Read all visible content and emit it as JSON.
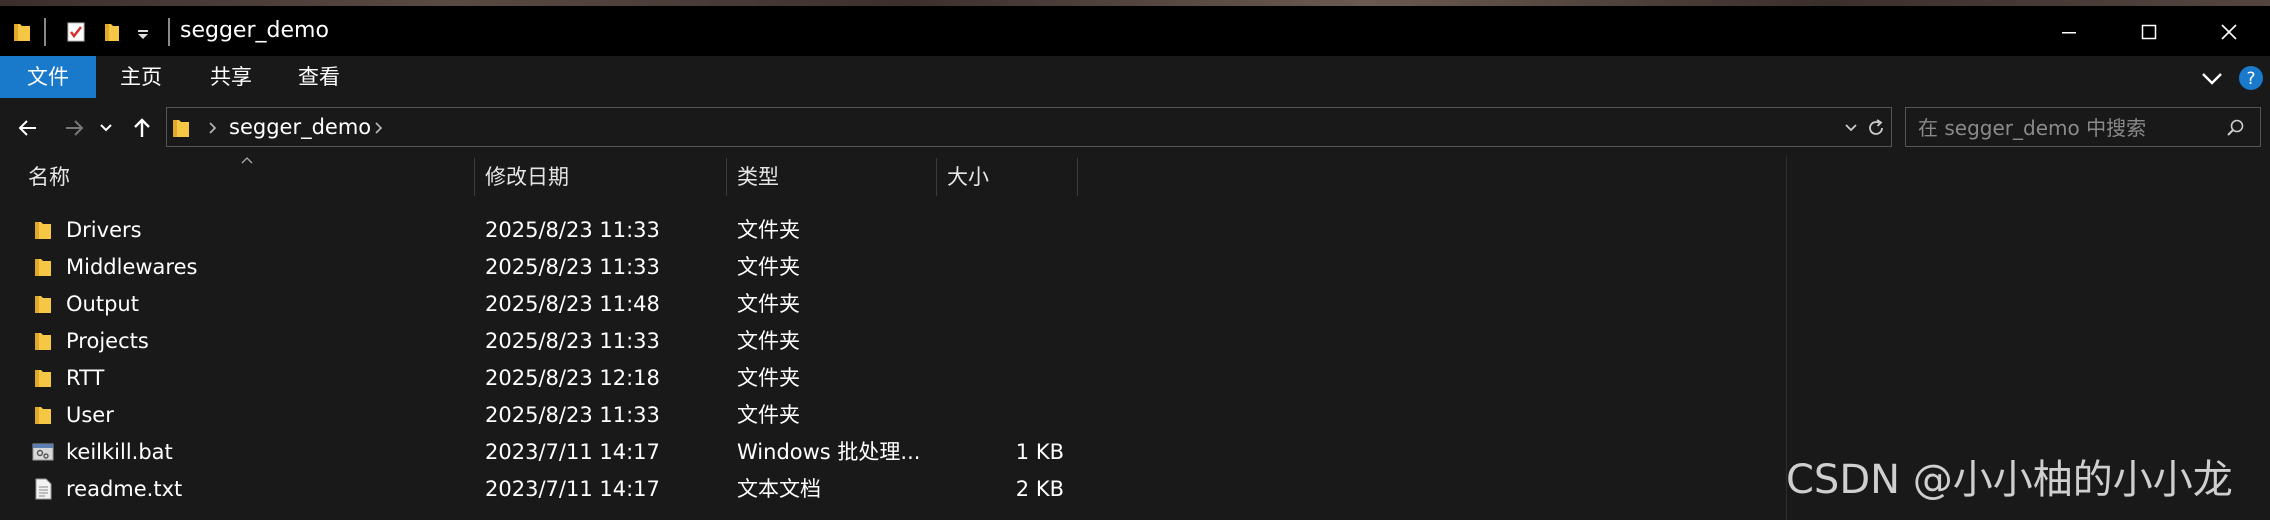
{
  "window": {
    "title": "segger_demo",
    "controls": {
      "minimize": "minimize-icon",
      "maximize": "maximize-icon",
      "close": "close-icon"
    }
  },
  "ribbon": {
    "tabs": [
      {
        "label": "文件",
        "active": true
      },
      {
        "label": "主页"
      },
      {
        "label": "共享"
      },
      {
        "label": "查看"
      }
    ]
  },
  "address": {
    "breadcrumb": "segger_demo",
    "search_placeholder": "在 segger_demo 中搜索"
  },
  "columns": {
    "name": "名称",
    "date": "修改日期",
    "type": "类型",
    "size": "大小"
  },
  "files": [
    {
      "name": "Drivers",
      "date": "2025/8/23 11:33",
      "type": "文件夹",
      "size": "",
      "icon": "folder-icon"
    },
    {
      "name": "Middlewares",
      "date": "2025/8/23 11:33",
      "type": "文件夹",
      "size": "",
      "icon": "folder-icon"
    },
    {
      "name": "Output",
      "date": "2025/8/23 11:48",
      "type": "文件夹",
      "size": "",
      "icon": "folder-icon"
    },
    {
      "name": "Projects",
      "date": "2025/8/23 11:33",
      "type": "文件夹",
      "size": "",
      "icon": "folder-icon"
    },
    {
      "name": "RTT",
      "date": "2025/8/23 12:18",
      "type": "文件夹",
      "size": "",
      "icon": "folder-icon"
    },
    {
      "name": "User",
      "date": "2025/8/23 11:33",
      "type": "文件夹",
      "size": "",
      "icon": "folder-icon"
    },
    {
      "name": "keilkill.bat",
      "date": "2023/7/11 14:17",
      "type": "Windows 批处理...",
      "size": "1 KB",
      "icon": "batch-file-icon"
    },
    {
      "name": "readme.txt",
      "date": "2023/7/11 14:17",
      "type": "文本文档",
      "size": "2 KB",
      "icon": "text-file-icon"
    }
  ],
  "watermark": "CSDN @小小柚的小小龙",
  "colors": {
    "accent": "#1979ca",
    "folder": "#f6c744",
    "background": "#191919",
    "titlebar": "#000000"
  }
}
